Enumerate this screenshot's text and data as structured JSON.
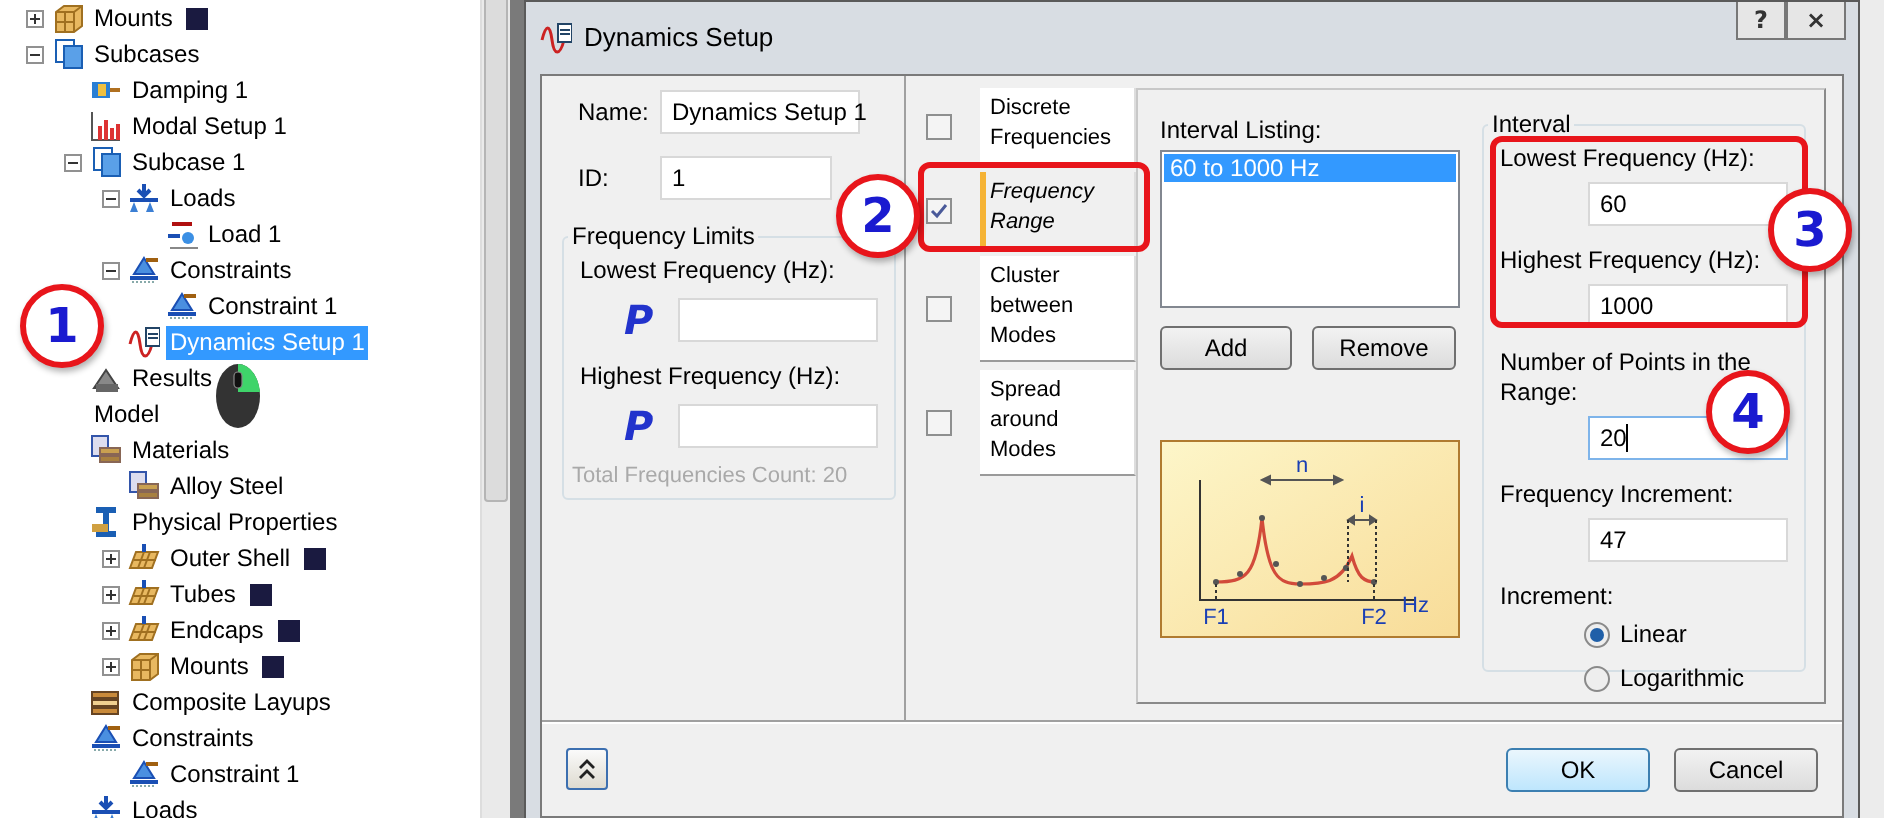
{
  "tree": [
    {
      "label": "Mounts",
      "kind": "cube",
      "expanded": false,
      "selected": false,
      "swatch": true
    },
    {
      "label": "Subcases",
      "kind": "pages",
      "expanded": true,
      "selected": false,
      "swatch": false,
      "children": [
        {
          "label": "Damping 1",
          "kind": "damper",
          "selected": false,
          "swatch": false
        },
        {
          "label": "Modal Setup 1",
          "kind": "bars",
          "selected": false,
          "swatch": false
        },
        {
          "label": "Subcase 1",
          "kind": "pages",
          "expanded": true,
          "selected": false,
          "swatch": false,
          "children": [
            {
              "label": "Loads",
              "kind": "load",
              "expanded": true,
              "selected": false,
              "swatch": false,
              "children": [
                {
                  "label": "Load 1",
                  "kind": "force",
                  "selected": false,
                  "swatch": false
                }
              ]
            },
            {
              "label": "Constraints",
              "kind": "support",
              "expanded": true,
              "selected": false,
              "swatch": false,
              "children": [
                {
                  "label": "Constraint 1",
                  "kind": "support",
                  "selected": false,
                  "swatch": false
                }
              ]
            },
            {
              "label": "Dynamics Setup 1",
              "kind": "wave",
              "selected": true,
              "swatch": false
            }
          ]
        },
        {
          "label": "Results",
          "kind": "results",
          "selected": false,
          "swatch": false
        }
      ]
    },
    {
      "label": "Model",
      "selected": false,
      "swatch": false,
      "children": [
        {
          "label": "Materials",
          "kind": "materials",
          "selected": false,
          "swatch": false,
          "children": [
            {
              "label": "Alloy Steel",
              "kind": "materials",
              "selected": false,
              "swatch": false
            }
          ]
        },
        {
          "label": "Physical Properties",
          "kind": "beam",
          "selected": false,
          "swatch": false,
          "children": [
            {
              "label": "Outer Shell",
              "kind": "shell",
              "expanded": false,
              "selected": false,
              "swatch": true
            },
            {
              "label": "Tubes",
              "kind": "shell",
              "expanded": false,
              "selected": false,
              "swatch": true
            },
            {
              "label": "Endcaps",
              "kind": "shell",
              "expanded": false,
              "selected": false,
              "swatch": true
            },
            {
              "label": "Mounts",
              "kind": "cube",
              "expanded": false,
              "selected": false,
              "swatch": true
            }
          ]
        },
        {
          "label": "Composite Layups",
          "kind": "layup",
          "selected": false,
          "swatch": false
        },
        {
          "label": "Constraints",
          "kind": "support",
          "selected": false,
          "swatch": false,
          "children": [
            {
              "label": "Constraint 1",
              "kind": "support",
              "selected": false,
              "swatch": false
            }
          ]
        },
        {
          "label": "Loads",
          "kind": "load",
          "selected": false,
          "swatch": false
        }
      ]
    }
  ],
  "dialog": {
    "title": "Dynamics Setup",
    "help_button": "?",
    "close_button": "×",
    "name": {
      "label": "Name:",
      "value": "Dynamics Setup 1"
    },
    "id": {
      "label": "ID:",
      "value": "1"
    },
    "frequency_limits": {
      "title": "Frequency Limits",
      "fields": [
        {
          "label": "Lowest Frequency (Hz):",
          "parameter": "P"
        },
        {
          "label": "Highest Frequency (Hz):",
          "parameter": "P"
        }
      ],
      "total": {
        "text": "Total Frequencies Count: 20",
        "disabled": true
      }
    },
    "tabs": [
      {
        "label": "Discrete Frequencies",
        "checked": false,
        "selected": false
      },
      {
        "label": "Frequency Range",
        "checked": true,
        "selected": true
      },
      {
        "label": "Cluster between Modes",
        "checked": false,
        "selected": false
      },
      {
        "label": "Spread around Modes",
        "checked": false,
        "selected": false
      }
    ],
    "interval_listing": {
      "label": "Interval Listing:",
      "items": [
        {
          "text": "60 to 1000 Hz",
          "selected": true
        }
      ],
      "buttons": [
        "Add",
        "Remove"
      ]
    },
    "diagram_labels": [
      "n",
      "i",
      "F1",
      "F2",
      "Hz"
    ],
    "interval": {
      "title": "Interval",
      "fields": [
        {
          "label": "Lowest Frequency (Hz):",
          "value": "60",
          "focused": false
        },
        {
          "label": "Highest Frequency (Hz):",
          "value": "1000",
          "focused": false
        },
        {
          "label": "Number of Points in the Range:",
          "value": "20",
          "focused": true
        },
        {
          "label": "Frequency Increment:",
          "value": "47",
          "focused": false
        }
      ],
      "increment": {
        "label": "Increment:",
        "options": [
          {
            "label": "Linear",
            "selected": true
          },
          {
            "label": "Logarithmic",
            "selected": false
          }
        ]
      }
    },
    "buttons": [
      {
        "label": "OK",
        "default": true
      },
      {
        "label": "Cancel",
        "default": false
      }
    ]
  },
  "annotations": [
    "1",
    "2",
    "3",
    "4"
  ]
}
